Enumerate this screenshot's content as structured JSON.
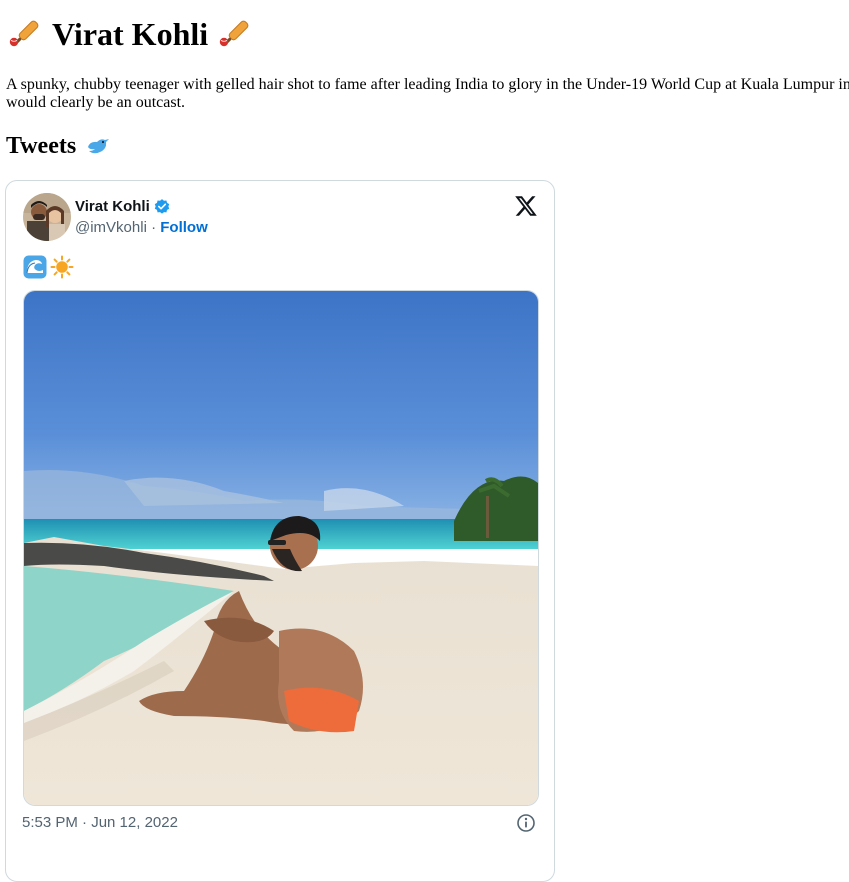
{
  "page": {
    "title": "Virat Kohli",
    "intro_line1": "A spunky, chubby teenager with gelled hair shot to fame after leading India to glory in the Under-19 World Cup at Kuala Lumpur in",
    "intro_line2": "would clearly be an outcast.",
    "tweets_heading": "Tweets",
    "title_icon": "cricket-bat-icon",
    "tweets_icon": "bird-icon"
  },
  "tweet": {
    "author_name": "Virat Kohli",
    "handle": "@imVkohli",
    "separator": " · ",
    "follow_label": "Follow",
    "text_emojis": [
      "wave-emoji",
      "sun-emoji"
    ],
    "timestamp": "5:53 PM · Jun 12, 2022",
    "verified_color": "#1d9bf0",
    "follow_color": "#006fd6",
    "brand_icon": "x-logo-icon",
    "info_icon": "info-icon"
  }
}
